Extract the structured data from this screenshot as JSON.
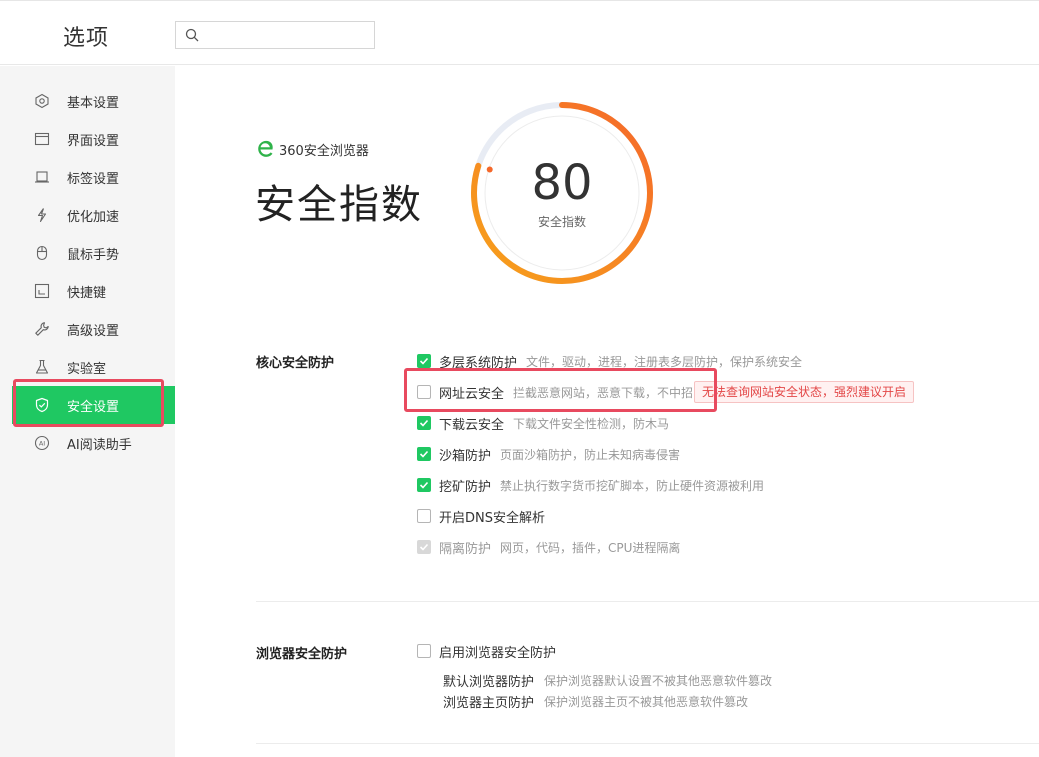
{
  "header": {
    "title": "选项",
    "search": {
      "value": "",
      "placeholder": ""
    }
  },
  "sidebar": {
    "items": [
      {
        "label": "基本设置",
        "icon": "hexagon-settings-icon",
        "active": false
      },
      {
        "label": "界面设置",
        "icon": "window-icon",
        "active": false
      },
      {
        "label": "标签设置",
        "icon": "tab-icon",
        "active": false
      },
      {
        "label": "优化加速",
        "icon": "lightning-icon",
        "active": false
      },
      {
        "label": "鼠标手势",
        "icon": "mouse-icon",
        "active": false
      },
      {
        "label": "快捷键",
        "icon": "keyboard-shortcut-icon",
        "active": false
      },
      {
        "label": "高级设置",
        "icon": "wrench-icon",
        "active": false
      },
      {
        "label": "实验室",
        "icon": "flask-icon",
        "active": true
      },
      {
        "label": "安全设置",
        "icon": "shield-check-icon",
        "active": true
      },
      {
        "label": "AI阅读助手",
        "icon": "ai-assistant-icon",
        "active": false
      }
    ]
  },
  "brand": {
    "name": "360安全浏览器",
    "logo_color": "#2fb34a"
  },
  "page_title": "安全指数",
  "gauge": {
    "score": "80",
    "label": "安全指数",
    "fraction": 0.8,
    "color_start": "#f7a21b",
    "color_end": "#f5682a"
  },
  "core": {
    "title": "核心安全防护",
    "options": [
      {
        "label": "多层系统防护",
        "desc": "文件，驱动，进程，注册表多层防护，保护系统安全",
        "checked": true,
        "disabled": false
      },
      {
        "label": "网址云安全",
        "desc": "拦截恶意网站，恶意下载，不中招",
        "checked": false,
        "disabled": false
      },
      {
        "label": "下载云安全",
        "desc": "下载文件安全性检测，防木马",
        "checked": true,
        "disabled": false
      },
      {
        "label": "沙箱防护",
        "desc": "页面沙箱防护，防止未知病毒侵害",
        "checked": true,
        "disabled": false
      },
      {
        "label": "挖矿防护",
        "desc": "禁止执行数字货币挖矿脚本，防止硬件资源被利用",
        "checked": true,
        "disabled": false
      },
      {
        "label": "开启DNS安全解析",
        "desc": "",
        "checked": false,
        "disabled": false
      },
      {
        "label": "隔离防护",
        "desc": "网页，代码，插件，CPU进程隔离",
        "checked": true,
        "disabled": true
      }
    ],
    "warning": "无法查询网站安全状态，强烈建议开启"
  },
  "browser": {
    "title": "浏览器安全防护",
    "main_option": {
      "label": "启用浏览器安全防护",
      "checked": false
    },
    "sub_items": [
      {
        "label": "默认浏览器防护",
        "desc": "保护浏览器默认设置不被其他恶意软件篡改"
      },
      {
        "label": "浏览器主页防护",
        "desc": "保护浏览器主页不被其他恶意软件篡改"
      }
    ]
  },
  "colors": {
    "accent": "#1fc862",
    "highlight": "#e84a5f",
    "warning_text": "#e34747"
  }
}
